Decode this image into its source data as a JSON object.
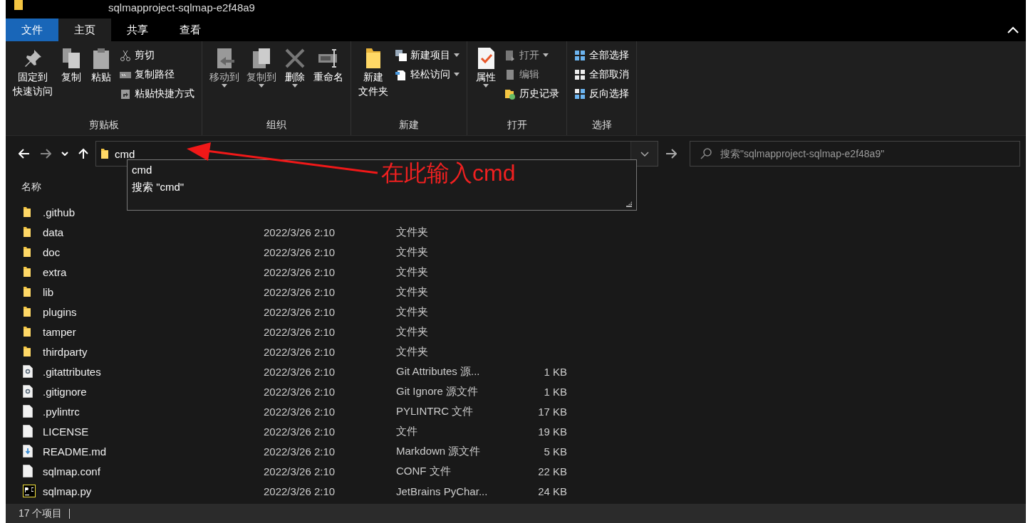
{
  "window": {
    "title": "sqlmapproject-sqlmap-e2f48a9"
  },
  "tabs": [
    {
      "label": "文件",
      "selected": false,
      "kind": "file"
    },
    {
      "label": "主页",
      "selected": true,
      "kind": "tab"
    },
    {
      "label": "共享",
      "selected": false,
      "kind": "tab"
    },
    {
      "label": "查看",
      "selected": false,
      "kind": "tab"
    }
  ],
  "ribbon": [
    {
      "label": "剪贴板",
      "large": [
        {
          "lines": [
            "固定到",
            "快速访问"
          ],
          "disabled": false,
          "caret": false
        },
        {
          "lines": [
            "复制"
          ],
          "disabled": false,
          "caret": false
        },
        {
          "lines": [
            "粘贴"
          ],
          "disabled": false,
          "caret": false
        }
      ],
      "small": [
        {
          "label": "剪切",
          "disabled": false,
          "caret": false
        },
        {
          "label": "复制路径",
          "disabled": false,
          "caret": false
        },
        {
          "label": "粘贴快捷方式",
          "disabled": false,
          "caret": false
        }
      ]
    },
    {
      "label": "组织",
      "large": [
        {
          "lines": [
            "移动到"
          ],
          "disabled": true,
          "caret": true
        },
        {
          "lines": [
            "复制到"
          ],
          "disabled": true,
          "caret": true
        },
        {
          "lines": [
            "删除"
          ],
          "disabled": false,
          "caret": true
        },
        {
          "lines": [
            "重命名"
          ],
          "disabled": false,
          "caret": false
        }
      ]
    },
    {
      "label": "新建",
      "large": [
        {
          "lines": [
            "新建",
            "文件夹"
          ],
          "disabled": false,
          "caret": false
        }
      ],
      "small": [
        {
          "label": "新建项目",
          "disabled": false,
          "caret": true
        },
        {
          "label": "轻松访问",
          "disabled": false,
          "caret": true
        }
      ]
    },
    {
      "label": "打开",
      "large": [
        {
          "lines": [
            "属性"
          ],
          "disabled": false,
          "caret": true
        }
      ],
      "small": [
        {
          "label": "打开",
          "disabled": true,
          "caret": true
        },
        {
          "label": "编辑",
          "disabled": true,
          "caret": false
        },
        {
          "label": "历史记录",
          "disabled": false,
          "caret": false
        }
      ]
    },
    {
      "label": "选择",
      "small": [
        {
          "label": "全部选择",
          "disabled": false,
          "caret": false
        },
        {
          "label": "全部取消",
          "disabled": false,
          "caret": false
        },
        {
          "label": "反向选择",
          "disabled": false,
          "caret": false
        }
      ]
    }
  ],
  "address": {
    "value": "cmd"
  },
  "search": {
    "placeholder": "搜索\"sqlmapproject-sqlmap-e2f48a9\""
  },
  "suggestions": [
    "cmd",
    "搜索 \"cmd\""
  ],
  "columns": [
    "名称"
  ],
  "files": [
    {
      "name": ".github",
      "kind": "folder"
    },
    {
      "name": "data",
      "date": "2022/3/26 2:10",
      "type": "文件夹",
      "kind": "folder"
    },
    {
      "name": "doc",
      "date": "2022/3/26 2:10",
      "type": "文件夹",
      "kind": "folder"
    },
    {
      "name": "extra",
      "date": "2022/3/26 2:10",
      "type": "文件夹",
      "kind": "folder"
    },
    {
      "name": "lib",
      "date": "2022/3/26 2:10",
      "type": "文件夹",
      "kind": "folder"
    },
    {
      "name": "plugins",
      "date": "2022/3/26 2:10",
      "type": "文件夹",
      "kind": "folder"
    },
    {
      "name": "tamper",
      "date": "2022/3/26 2:10",
      "type": "文件夹",
      "kind": "folder"
    },
    {
      "name": "thirdparty",
      "date": "2022/3/26 2:10",
      "type": "文件夹",
      "kind": "folder"
    },
    {
      "name": ".gitattributes",
      "date": "2022/3/26 2:10",
      "type": "Git Attributes 源...",
      "size": "1 KB",
      "kind": "settings"
    },
    {
      "name": ".gitignore",
      "date": "2022/3/26 2:10",
      "type": "Git Ignore 源文件",
      "size": "1 KB",
      "kind": "settings"
    },
    {
      "name": ".pylintrc",
      "date": "2022/3/26 2:10",
      "type": "PYLINTRC 文件",
      "size": "17 KB",
      "kind": "plain"
    },
    {
      "name": "LICENSE",
      "date": "2022/3/26 2:10",
      "type": "文件",
      "size": "19 KB",
      "kind": "plain"
    },
    {
      "name": "README.md",
      "date": "2022/3/26 2:10",
      "type": "Markdown 源文件",
      "size": "5 KB",
      "kind": "markdown"
    },
    {
      "name": "sqlmap.conf",
      "date": "2022/3/26 2:10",
      "type": "CONF 文件",
      "size": "22 KB",
      "kind": "plain"
    },
    {
      "name": "sqlmap.py",
      "date": "2022/3/26 2:10",
      "type": "JetBrains PyChar...",
      "size": "24 KB",
      "kind": "pycharm"
    }
  ],
  "status_bar": {
    "count": "17 个项目"
  },
  "annotation": {
    "text": "在此输入cmd"
  }
}
